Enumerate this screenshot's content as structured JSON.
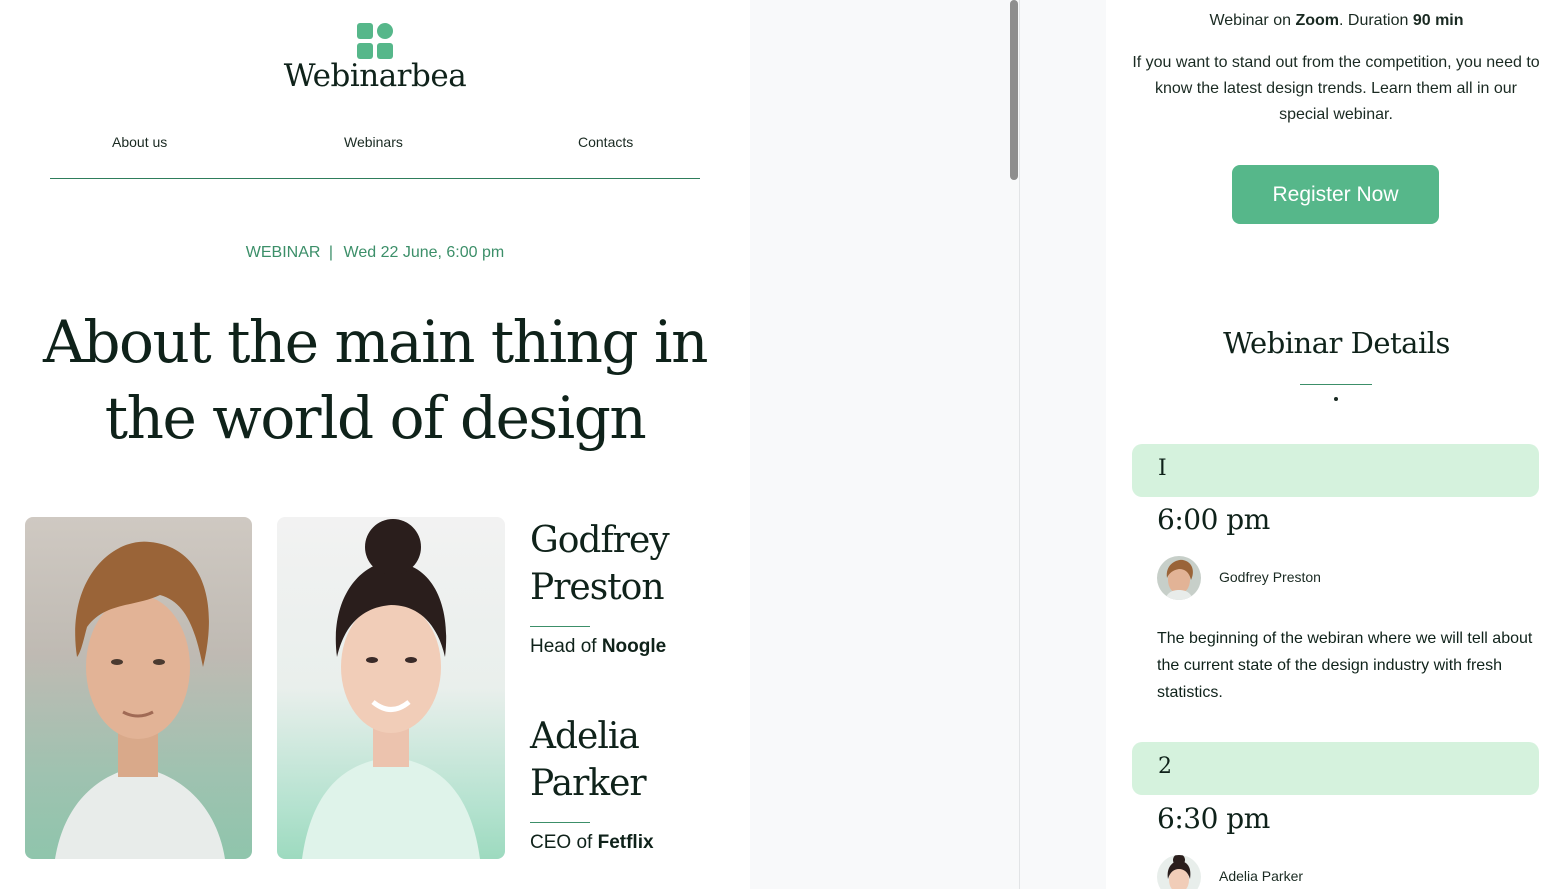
{
  "brand": {
    "name": "Webinarbea",
    "logo_icon": "grid-logo-icon",
    "accent": "#56b78a"
  },
  "nav": {
    "items": [
      "About us",
      "Webinars",
      "Contacts"
    ]
  },
  "event": {
    "tag": "WEBINAR",
    "separator": "|",
    "date": "Wed 22 June,",
    "time": "6:00 pm",
    "headline": "About the main thing in the world of design"
  },
  "speakers": [
    {
      "name": "Godfrey\nPreston",
      "role_prefix": "Head of",
      "company": "Noogle"
    },
    {
      "name": "Adelia\nParker",
      "role_prefix": "CEO of",
      "company": "Fetflix"
    }
  ],
  "info": {
    "platform_prefix": "Webinar on",
    "platform": "Zoom",
    "duration_prefix": ". Duration",
    "duration": "90 min",
    "description": "If you want to stand out from the competition, you need to know the latest design trends. Learn them all in our special webinar.",
    "register_label": "Register Now"
  },
  "details": {
    "title": "Webinar Details",
    "sessions": [
      {
        "number": "I",
        "time": "6:00 pm",
        "speaker": "Godfrey Preston",
        "description": "The beginning of the webiran where we will tell about the current state of the design industry with fresh statistics."
      },
      {
        "number": "2",
        "time": "6:30 pm",
        "speaker": "Adelia Parker"
      }
    ]
  },
  "colors": {
    "accent": "#56b78a",
    "accent_dark": "#3c8f69",
    "session_band": "#d5f2dd",
    "text": "#0f221a"
  }
}
